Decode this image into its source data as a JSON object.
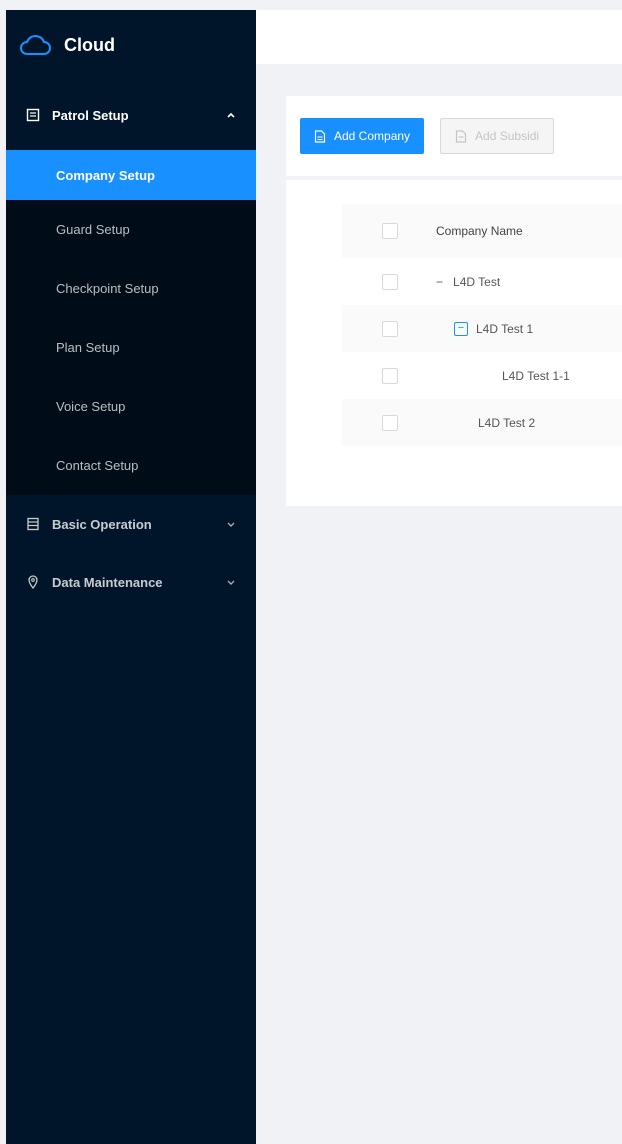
{
  "app": {
    "title": "Cloud"
  },
  "sidebar": {
    "patrol_setup": {
      "label": "Patrol Setup",
      "items": [
        {
          "label": "Company Setup"
        },
        {
          "label": "Guard Setup"
        },
        {
          "label": "Checkpoint Setup"
        },
        {
          "label": "Plan Setup"
        },
        {
          "label": "Voice Setup"
        },
        {
          "label": "Contact Setup"
        }
      ]
    },
    "basic_operation": {
      "label": "Basic Operation"
    },
    "data_maintenance": {
      "label": "Data Maintenance"
    }
  },
  "toolbar": {
    "add_company_label": "Add Company",
    "add_subsidiary_label": "Add Subsidi"
  },
  "table": {
    "columns": [
      "Company Name"
    ],
    "rows": [
      {
        "name": "L4D Test",
        "level": 0,
        "expander": "−"
      },
      {
        "name": "L4D Test 1",
        "level": 1,
        "expander": "−"
      },
      {
        "name": "L4D Test 1-1",
        "level": 2
      },
      {
        "name": "L4D Test 2",
        "level": 1
      }
    ]
  },
  "colors": {
    "sidebar_bg": "#001529",
    "submenu_bg": "#000c17",
    "accent": "#1890ff",
    "page_bg": "#f0f2f5"
  }
}
